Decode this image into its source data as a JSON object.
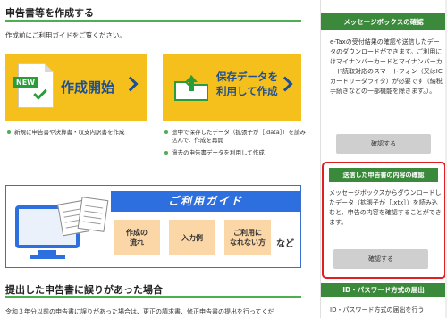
{
  "create_section": {
    "title": "申告書等を作成する",
    "lead": "作成前にご利用ガイドをご覧ください。",
    "start_card": {
      "badge": "NEW",
      "title": "作成開始",
      "bullets": [
        "新規に申告書や決算書・収支内訳書を作成"
      ]
    },
    "resume_card": {
      "title_line1": "保存データを",
      "title_line2": "利用して作成",
      "bullets": [
        "途中で保存したデータ（拡張子が［.data］）を読み込んで、作成を再開",
        "過去の申告書データを利用して作成"
      ]
    },
    "guide": {
      "title": "ご利用ガイド",
      "buttons": [
        {
          "line1": "作成の",
          "line2": "流れ"
        },
        {
          "line1": "入力例",
          "line2": ""
        },
        {
          "line1": "ご利用に",
          "line2": "なれない方"
        }
      ],
      "etc": "など"
    }
  },
  "error_section": {
    "title": "提出した申告書に誤りがあった場合",
    "text": "令和３年分以前の申告書に誤りがあった場合は、更正の請求書、修正申告書の提出を行ってくだ"
  },
  "sidebar": {
    "message_box": {
      "title": "メッセージボックスの確認",
      "text": "e-Taxの受付結果の確認や送信したデータのダウンロードができます。ご利用にはマイナンバーカードとマイナンバーカード読取対応のスマートフォン（又はICカードリーダライタ）が必要です（納税手続きなどの一部機能を除きます。）。",
      "button": "確認する"
    },
    "submitted_check": {
      "title": "送信した申告書の内容の確認",
      "text": "メッセージボックスからダウンロードしたデータ（拡張子が［.xtx］）を読み込むと、申告の内容を確認することができます。",
      "button": "確認する"
    },
    "id_password": {
      "title": "ID・パスワード方式の届出",
      "text": "ID・パスワード方式の届出を行う"
    }
  },
  "colors": {
    "accent_green": "#3b8a3b",
    "card_yellow": "#f5c01b",
    "title_blue": "#1d4f95",
    "guide_blue": "#2e6fe0",
    "highlight_red": "#e02020"
  }
}
